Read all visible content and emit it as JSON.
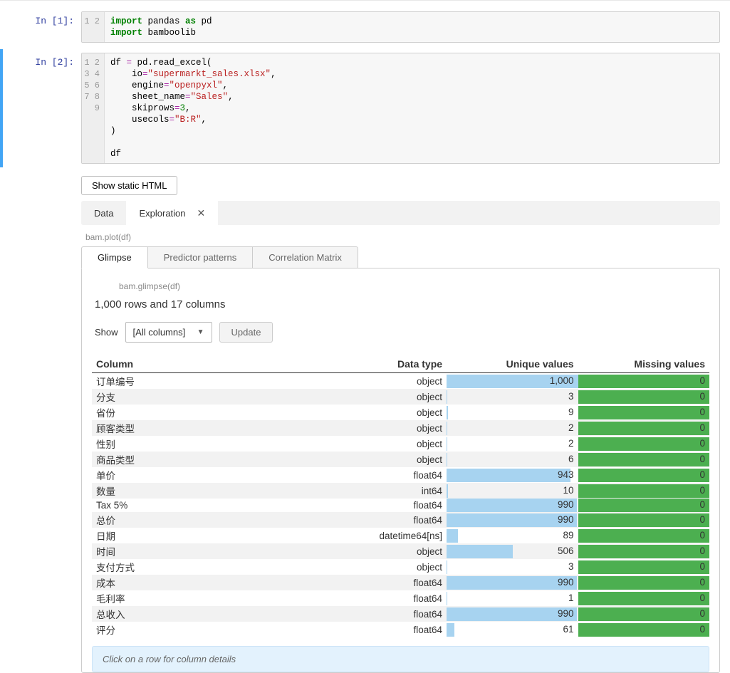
{
  "cells": {
    "c1": {
      "prompt": "In [1]:",
      "gutter": [
        "1",
        "2"
      ],
      "tokens": [
        [
          {
            "t": "kw",
            "v": "import"
          },
          {
            "t": "nm",
            "v": " pandas "
          },
          {
            "t": "kw",
            "v": "as"
          },
          {
            "t": "nm",
            "v": " pd"
          }
        ],
        [
          {
            "t": "kw",
            "v": "import"
          },
          {
            "t": "nm",
            "v": " bamboolib"
          }
        ]
      ]
    },
    "c2": {
      "prompt": "In [2]:",
      "gutter": [
        "1",
        "2",
        "3",
        "4",
        "5",
        "6",
        "7",
        "8",
        "9"
      ],
      "tokens": [
        [
          {
            "t": "nm",
            "v": "df "
          },
          {
            "t": "op",
            "v": "="
          },
          {
            "t": "nm",
            "v": " pd.read_excel("
          }
        ],
        [
          {
            "t": "nm",
            "v": "    io"
          },
          {
            "t": "op",
            "v": "="
          },
          {
            "t": "str",
            "v": "\"supermarkt_sales.xlsx\""
          },
          {
            "t": "nm",
            "v": ","
          }
        ],
        [
          {
            "t": "nm",
            "v": "    engine"
          },
          {
            "t": "op",
            "v": "="
          },
          {
            "t": "str",
            "v": "\"openpyxl\""
          },
          {
            "t": "nm",
            "v": ","
          }
        ],
        [
          {
            "t": "nm",
            "v": "    sheet_name"
          },
          {
            "t": "op",
            "v": "="
          },
          {
            "t": "str",
            "v": "\"Sales\""
          },
          {
            "t": "nm",
            "v": ","
          }
        ],
        [
          {
            "t": "nm",
            "v": "    skiprows"
          },
          {
            "t": "op",
            "v": "="
          },
          {
            "t": "num",
            "v": "3"
          },
          {
            "t": "nm",
            "v": ","
          }
        ],
        [
          {
            "t": "nm",
            "v": "    usecols"
          },
          {
            "t": "op",
            "v": "="
          },
          {
            "t": "str",
            "v": "\"B:R\""
          },
          {
            "t": "nm",
            "v": ","
          }
        ],
        [
          {
            "t": "nm",
            "v": ")"
          }
        ],
        [
          {
            "t": "nm",
            "v": ""
          }
        ],
        [
          {
            "t": "nm",
            "v": "df"
          }
        ]
      ]
    }
  },
  "output": {
    "show_static_html": "Show static HTML",
    "tabs": {
      "data": "Data",
      "exploration": "Exploration"
    },
    "bam_plot": "bam.plot(df)",
    "sub_tabs": {
      "glimpse": "Glimpse",
      "predictor": "Predictor patterns",
      "correlation": "Correlation Matrix"
    },
    "bam_glimpse": "bam.glimpse(df)",
    "summary": "1,000 rows and 17 columns",
    "show_label": "Show",
    "show_value": "[All columns]",
    "update_btn": "Update",
    "headers": {
      "column": "Column",
      "dtype": "Data type",
      "unique": "Unique values",
      "missing": "Missing values"
    },
    "max_unique": 1000,
    "rows": [
      {
        "name": "订单编号",
        "dtype": "object",
        "unique": 1000,
        "unique_str": "1,000",
        "missing": 0
      },
      {
        "name": "分支",
        "dtype": "object",
        "unique": 3,
        "unique_str": "3",
        "missing": 0
      },
      {
        "name": "省份",
        "dtype": "object",
        "unique": 9,
        "unique_str": "9",
        "missing": 0
      },
      {
        "name": "顾客类型",
        "dtype": "object",
        "unique": 2,
        "unique_str": "2",
        "missing": 0
      },
      {
        "name": "性别",
        "dtype": "object",
        "unique": 2,
        "unique_str": "2",
        "missing": 0
      },
      {
        "name": "商品类型",
        "dtype": "object",
        "unique": 6,
        "unique_str": "6",
        "missing": 0
      },
      {
        "name": "单价",
        "dtype": "float64",
        "unique": 943,
        "unique_str": "943",
        "missing": 0
      },
      {
        "name": "数量",
        "dtype": "int64",
        "unique": 10,
        "unique_str": "10",
        "missing": 0
      },
      {
        "name": "Tax 5%",
        "dtype": "float64",
        "unique": 990,
        "unique_str": "990",
        "missing": 0
      },
      {
        "name": "总价",
        "dtype": "float64",
        "unique": 990,
        "unique_str": "990",
        "missing": 0
      },
      {
        "name": "日期",
        "dtype": "datetime64[ns]",
        "unique": 89,
        "unique_str": "89",
        "missing": 0
      },
      {
        "name": "时间",
        "dtype": "object",
        "unique": 506,
        "unique_str": "506",
        "missing": 0
      },
      {
        "name": "支付方式",
        "dtype": "object",
        "unique": 3,
        "unique_str": "3",
        "missing": 0
      },
      {
        "name": "成本",
        "dtype": "float64",
        "unique": 990,
        "unique_str": "990",
        "missing": 0
      },
      {
        "name": "毛利率",
        "dtype": "float64",
        "unique": 1,
        "unique_str": "1",
        "missing": 0
      },
      {
        "name": "总收入",
        "dtype": "float64",
        "unique": 990,
        "unique_str": "990",
        "missing": 0
      },
      {
        "name": "评分",
        "dtype": "float64",
        "unique": 61,
        "unique_str": "61",
        "missing": 0
      }
    ],
    "hint": "Click on a row for column details"
  }
}
